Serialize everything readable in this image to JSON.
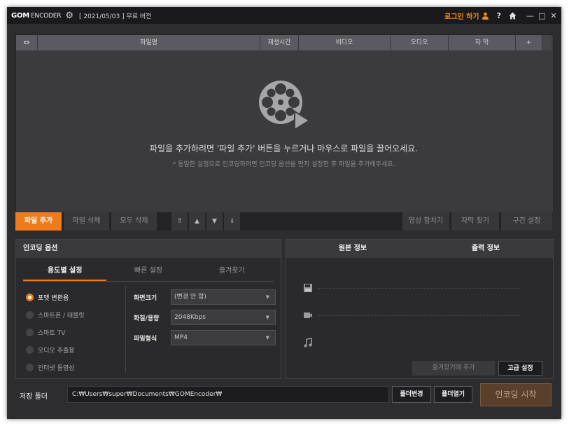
{
  "titlebar": {
    "logo_bold": "GOM",
    "logo_rest": "ENCODER",
    "version": "[ 2021/05/03 ] 무료 버전",
    "login": "로그인 하기",
    "help": "?",
    "accent": "#f07b1a"
  },
  "filelist": {
    "columns": {
      "link": "⇔",
      "filename": "파일명",
      "playtime": "재생시간",
      "video": "비디오",
      "audio": "오디오",
      "subtitle": "자 막",
      "plus": "+"
    },
    "hint_main": "파일을 추가하려면 '파일 추가' 버튼을 누르거나 마우스로 파일을 끌어오세요.",
    "hint_sub": "* 동일한 설정으로 인코딩하려면 인코딩 옵션을 먼저 설정한 후 파일을 추가해주세요."
  },
  "toolbar": {
    "add": "파일 추가",
    "delete": "파일 삭제",
    "delete_all": "모두 삭제",
    "move_top": "⇑",
    "move_up": "▲",
    "move_down": "▼",
    "move_bottom": "⇓",
    "merge": "영상 합치기",
    "find_subtitle": "자막 찾기",
    "section": "구간 설정"
  },
  "encoding": {
    "title": "인코딩 옵션",
    "tabs": [
      "용도별 설정",
      "빠른 설정",
      "즐겨찾기"
    ],
    "active_tab": 0,
    "presets": [
      "포맷 변환용",
      "스마트폰 / 태블릿",
      "스마트 TV",
      "오디오 추출용",
      "인터넷 동영상"
    ],
    "selected_preset": 0,
    "fields": {
      "size_label": "화면크기",
      "size_value": "(변경 안 함)",
      "quality_label": "화질/용량",
      "quality_value": "2048Kbps",
      "format_label": "파일형식",
      "format_value": "MP4"
    }
  },
  "info": {
    "source": "원본 정보",
    "output": "출력 정보",
    "icons": [
      "file-icon",
      "video-camera-icon",
      "music-note-icon"
    ],
    "add_favorite": "즐겨찾기에 추가",
    "advanced": "고급 설정"
  },
  "save": {
    "label": "저장 폴더",
    "path": "C:₩Users₩super₩Documents₩GOMEncoder₩",
    "change": "폴더변경",
    "open": "폴더열기",
    "start": "인코딩 시작"
  }
}
